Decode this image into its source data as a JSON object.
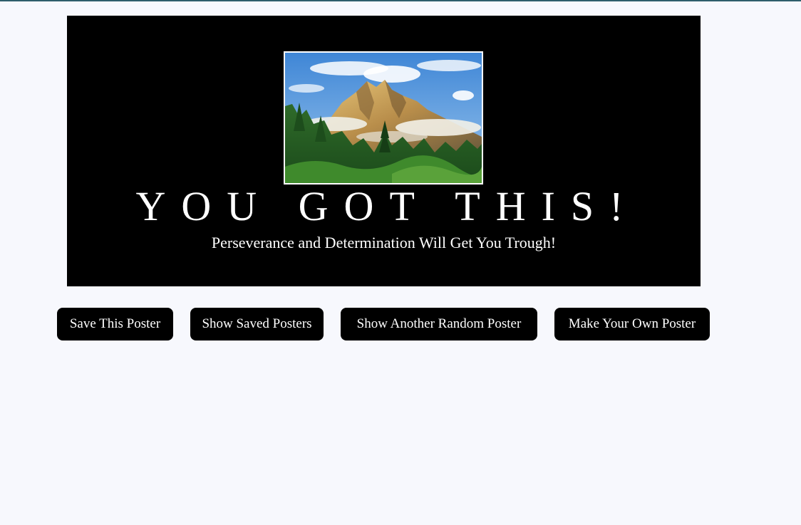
{
  "poster": {
    "image_alt": "mountain peak above forest",
    "title": "YOU GOT THIS!",
    "quote": "Perseverance and Determination Will Get You Trough!"
  },
  "buttons": {
    "save": "Save This Poster",
    "show_saved": "Show Saved Posters",
    "random": "Show Another Random Poster",
    "make_own": "Make Your Own Poster"
  },
  "colors": {
    "page_background": "#f7f8fd",
    "poster_background": "#000000",
    "button_background": "#000000",
    "text_light": "#ffffff",
    "top_rule": "#2e5d6b"
  }
}
